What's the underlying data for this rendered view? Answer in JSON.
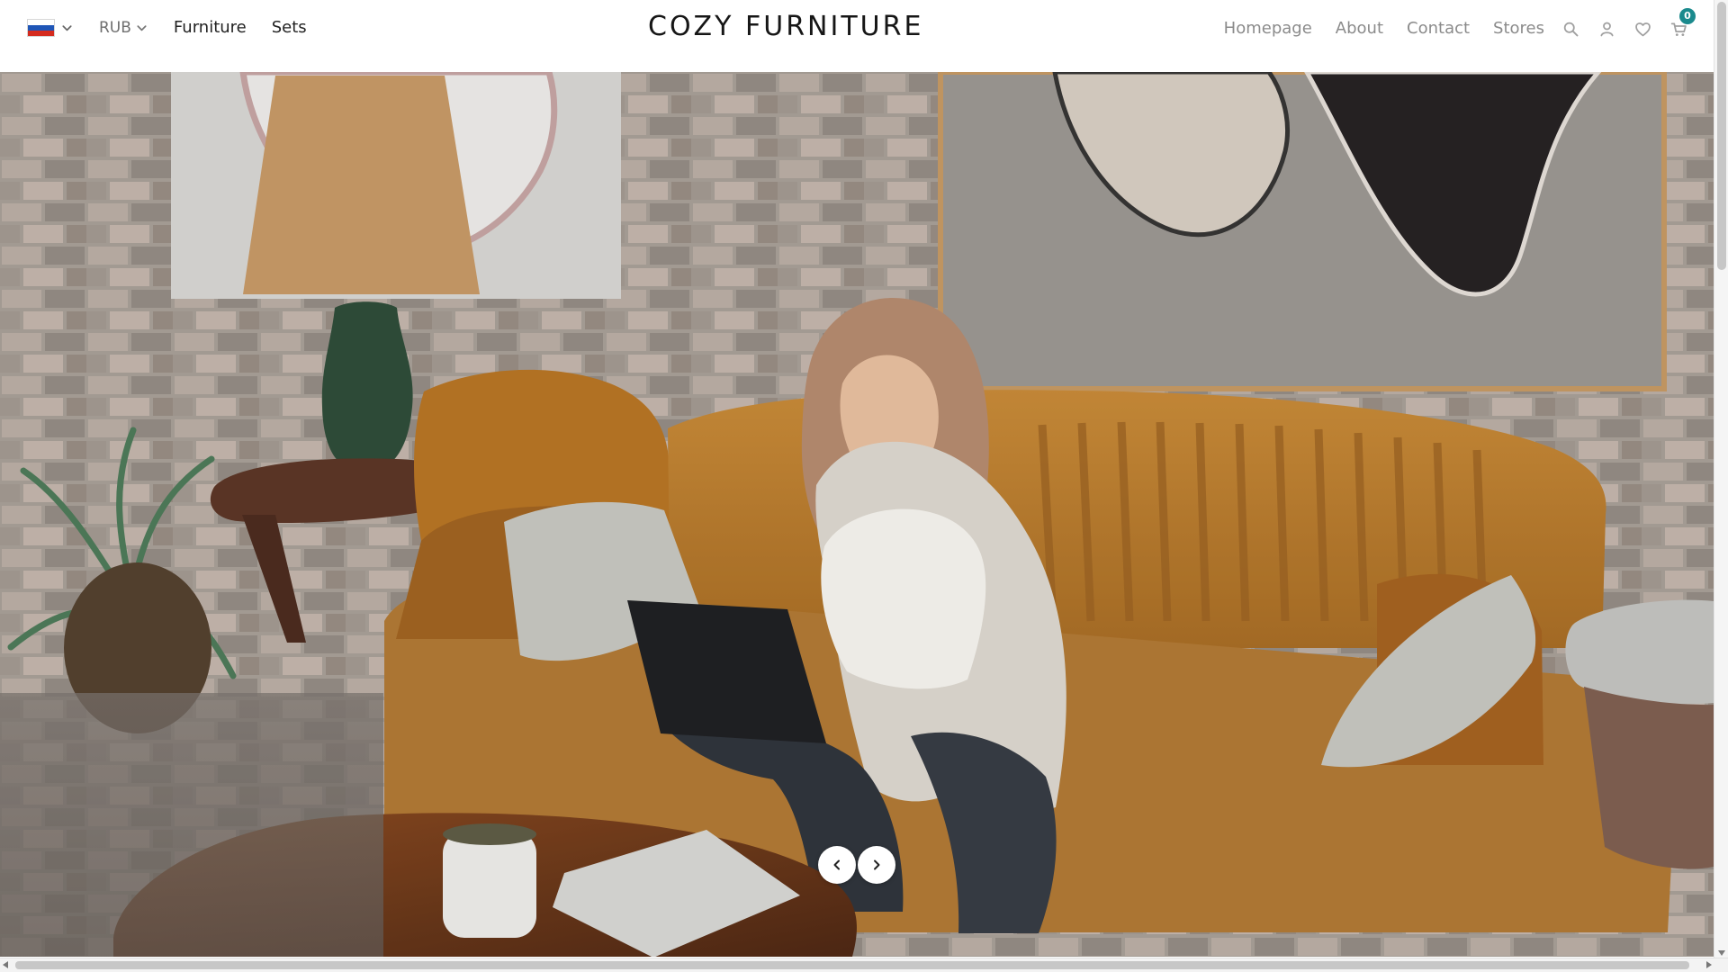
{
  "header": {
    "language": {
      "selected": "Russian",
      "flag_icon": "russia-flag-icon",
      "colors": [
        "#ffffff",
        "#1f56b7",
        "#d52b1e"
      ]
    },
    "currency": "RUB",
    "left_links": [
      {
        "label": "Furniture"
      },
      {
        "label": "Sets"
      }
    ],
    "logo": "COZY FURNITURE",
    "right_links": [
      {
        "label": "Homepage"
      },
      {
        "label": "About"
      },
      {
        "label": "Contact"
      },
      {
        "label": "Stores"
      }
    ],
    "icons": {
      "search": "search-icon",
      "account": "user-icon",
      "wishlist": "heart-icon",
      "cart": "cart-icon"
    },
    "cart_count": "0"
  },
  "hero": {
    "image": "woman using laptop on orange sofa in brick-wall living room",
    "controls": {
      "previous": "previous-slide",
      "next": "next-slide"
    }
  },
  "colors": {
    "accent": "#1b8a8d",
    "text_dark": "#161616",
    "text_muted": "#8b8b8b"
  }
}
